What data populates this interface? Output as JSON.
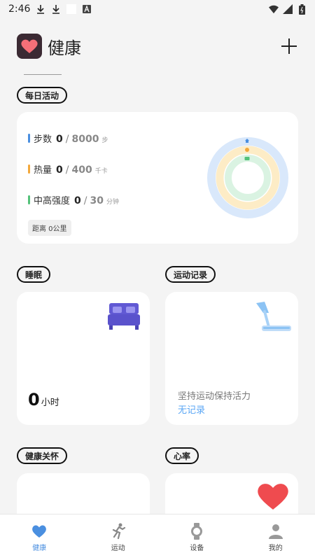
{
  "status_bar": {
    "time": "2:46"
  },
  "header": {
    "title": "健康"
  },
  "daily": {
    "title": "每日活动",
    "metrics": [
      {
        "name": "步数",
        "value": "0",
        "goal": "8000",
        "unit": "步",
        "color": "#4a8fe0"
      },
      {
        "name": "热量",
        "value": "0",
        "goal": "400",
        "unit": "千卡",
        "color": "#f3a83b"
      },
      {
        "name": "中高强度",
        "value": "0",
        "goal": "30",
        "unit": "分钟",
        "color": "#54c27a"
      }
    ],
    "distance": "距离 0公里",
    "ring_colors": {
      "outer": "#d9e8fb",
      "middle": "#fdecc6",
      "inner": "#daf3e2"
    }
  },
  "sleep": {
    "title": "睡眠",
    "value": "0",
    "unit": "小时"
  },
  "exercise": {
    "title": "运动记录",
    "subtitle": "坚持运动保持活力",
    "link": "无记录"
  },
  "care": {
    "title": "健康关怀"
  },
  "heart": {
    "title": "心率"
  },
  "nav": {
    "items": [
      {
        "label": "健康",
        "icon": "heart-icon"
      },
      {
        "label": "运动",
        "icon": "runner-icon"
      },
      {
        "label": "设备",
        "icon": "watch-icon"
      },
      {
        "label": "我的",
        "icon": "person-icon"
      }
    ],
    "active_color": "#4a8fe0"
  }
}
